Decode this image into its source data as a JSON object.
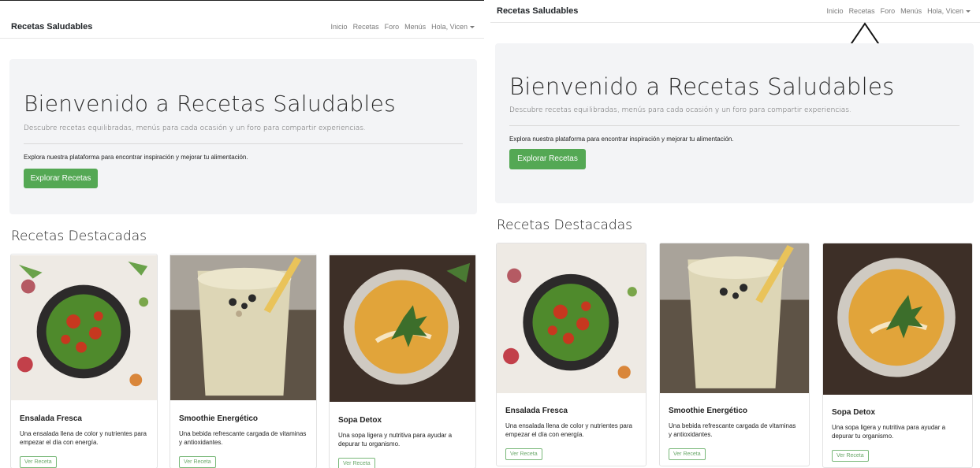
{
  "brand": "Recetas Saludables",
  "nav": {
    "inicio": "Inicio",
    "recetas": "Recetas",
    "foro": "Foro",
    "menus": "Menús",
    "user": "Hola, Vicen"
  },
  "hero": {
    "title": "Bienvenido a Recetas Saludables",
    "lead": "Descubre recetas equilibradas, menús para cada ocasión y un foro para compartir experiencias.",
    "text": "Explora nuestra plataforma para encontrar inspiración y mejorar tu alimentación.",
    "button": "Explorar Recetas"
  },
  "section_title": "Recetas Destacadas",
  "cards": [
    {
      "title": "Ensalada Fresca",
      "desc": "Una ensalada llena de color y nutrientes para empezar el día con energía.",
      "button": "Ver Receta"
    },
    {
      "title": "Smoothie Energético",
      "desc": "Una bebida refrescante cargada de vitaminas y antioxidantes.",
      "button": "Ver Receta"
    },
    {
      "title": "Sopa Detox",
      "desc": "Una sopa ligera y nutritiva para ayudar a depurar tu organismo.",
      "button": "Ver Receta"
    }
  ],
  "icons": [
    "up-arrow-annotation-icon"
  ],
  "colors": {
    "accent": "#54a854",
    "jumbotron": "#f3f4f6"
  }
}
